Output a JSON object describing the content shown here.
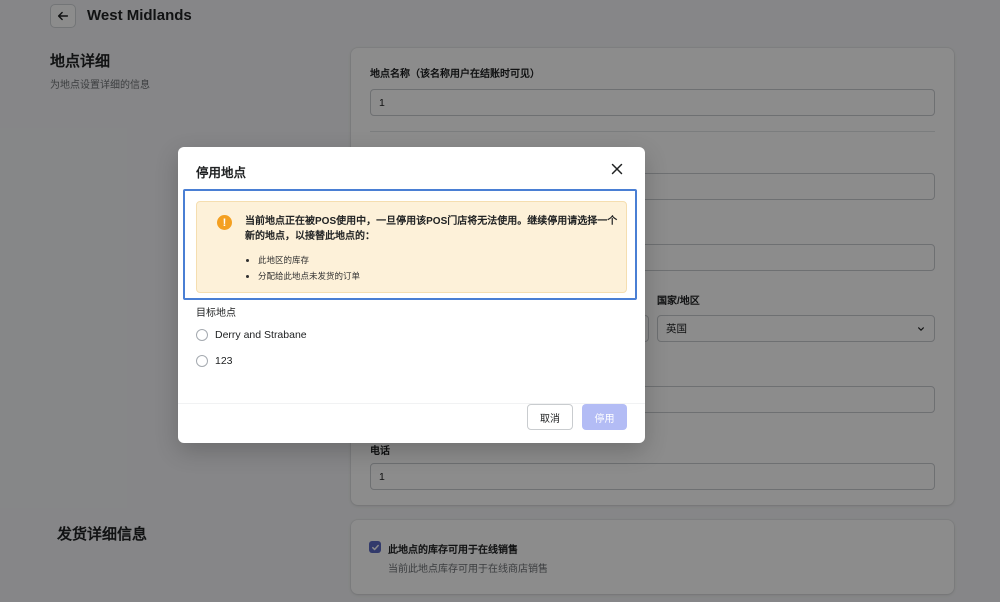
{
  "header": {
    "title": "West Midlands",
    "back_icon": "arrow-left-icon"
  },
  "location_details": {
    "title": "地点详细",
    "subtitle": "为地点设置详细的信息",
    "name_label": "地点名称（该名称用户在结账时可见）",
    "name_value": "1",
    "country_label": "国家/地区",
    "country_value": "英国",
    "phone_label": "电话",
    "phone_value": "1"
  },
  "shipping": {
    "title": "发货详细信息",
    "checkbox_label": "此地点的库存可用于在线销售",
    "checkbox_checked": true,
    "checkbox_help": "当前此地点库存可用于在线商店销售"
  },
  "modal": {
    "title": "停用地点",
    "close_icon": "close-icon",
    "warning": {
      "icon": "!",
      "text": "当前地点正在被POS使用中，一旦停用该POS门店将无法使用。继续停用请选择一个新的地点，以接替此地点的：",
      "items": [
        "此地区的库存",
        "分配给此地点未发货的订单"
      ],
      "color": "#f4a021"
    },
    "target_label": "目标地点",
    "options": [
      "Derry and Strabane",
      "123"
    ],
    "cancel_label": "取消",
    "deactivate_label": "停用",
    "accent_color": "#b3bcf5"
  }
}
